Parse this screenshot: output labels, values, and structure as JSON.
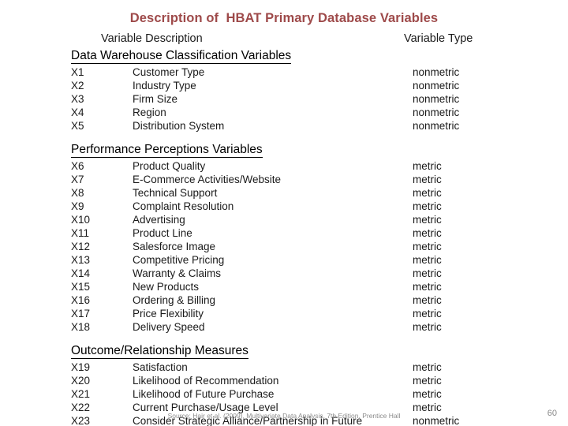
{
  "slide": {
    "title": "Description of  HBAT Primary Database Variables",
    "title_color": "#9E4A4A",
    "page_number": "60",
    "source_note": "Source: Hair et al. (2009), Multivariate Data Analysis, 7th Edition, Prentice Hall"
  },
  "columns": {
    "description_header": "Variable Description",
    "type_header": "Variable Type"
  },
  "sections": [
    {
      "heading": "Data Warehouse Classification Variables",
      "rows": [
        {
          "code": "X1",
          "description": "Customer Type",
          "type": "nonmetric"
        },
        {
          "code": "X2",
          "description": "Industry Type",
          "type": "nonmetric"
        },
        {
          "code": "X3",
          "description": "Firm Size",
          "type": "nonmetric"
        },
        {
          "code": "X4",
          "description": "Region",
          "type": "nonmetric"
        },
        {
          "code": "X5",
          "description": "Distribution System",
          "type": "nonmetric"
        }
      ]
    },
    {
      "heading": "Performance Perceptions Variables",
      "rows": [
        {
          "code": "X6",
          "description": "Product Quality",
          "type": "metric"
        },
        {
          "code": "X7",
          "description": "E-Commerce Activities/Website",
          "type": "metric"
        },
        {
          "code": "X8",
          "description": "Technical Support",
          "type": "metric"
        },
        {
          "code": "X9",
          "description": "Complaint Resolution",
          "type": "metric"
        },
        {
          "code": "X10",
          "description": "Advertising",
          "type": "metric"
        },
        {
          "code": "X11",
          "description": "Product Line",
          "type": "metric"
        },
        {
          "code": "X12",
          "description": "Salesforce Image",
          "type": "metric"
        },
        {
          "code": "X13",
          "description": "Competitive Pricing",
          "type": "metric"
        },
        {
          "code": "X14",
          "description": "Warranty & Claims",
          "type": "metric"
        },
        {
          "code": "X15",
          "description": "New Products",
          "type": "metric"
        },
        {
          "code": "X16",
          "description": "Ordering & Billing",
          "type": "metric"
        },
        {
          "code": "X17",
          "description": "Price Flexibility",
          "type": "metric"
        },
        {
          "code": "X18",
          "description": "Delivery Speed",
          "type": "metric"
        }
      ]
    },
    {
      "heading": "Outcome/Relationship Measures",
      "rows": [
        {
          "code": "X19",
          "description": "Satisfaction",
          "type": "metric"
        },
        {
          "code": "X20",
          "description": "Likelihood of Recommendation",
          "type": "metric"
        },
        {
          "code": "X21",
          "description": "Likelihood of Future Purchase",
          "type": "metric"
        },
        {
          "code": "X22",
          "description": "Current Purchase/Usage Level",
          "type": "metric"
        },
        {
          "code": "X23",
          "description": "Consider Strategic Alliance/Partnership in Future",
          "type": "nonmetric"
        }
      ]
    }
  ]
}
